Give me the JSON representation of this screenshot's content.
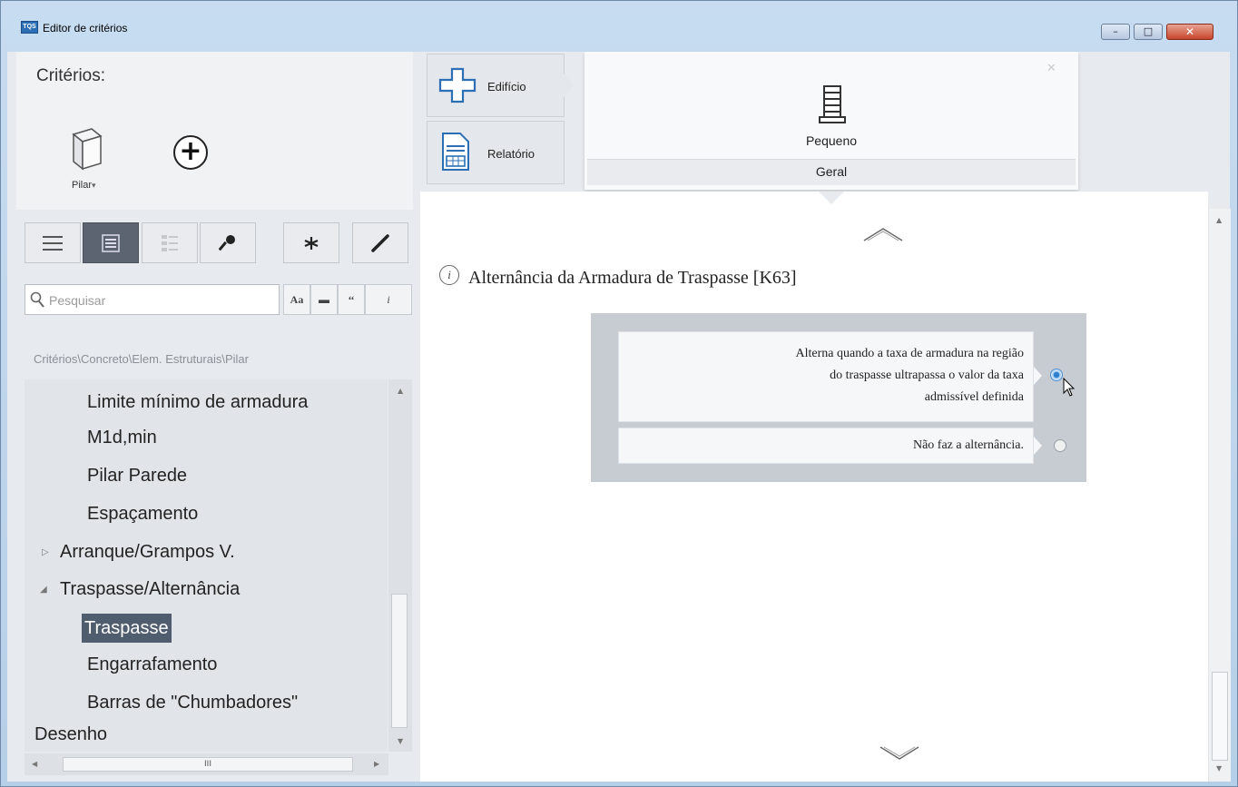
{
  "window": {
    "title": "Editor de critérios",
    "app_icon_text": "TQS",
    "controls": {
      "minimize": "–",
      "maximize": "□",
      "close": "✕"
    }
  },
  "left": {
    "criteria_title": "Critérios:",
    "element_selector": {
      "label": "Pilar",
      "dropdown_glyph": "▾",
      "icon": "cube-icon"
    },
    "add_button_glyph": "+",
    "toolbar": [
      {
        "name": "list-view-button",
        "icon": "list-icon",
        "active": false
      },
      {
        "name": "detail-list-view-button",
        "icon": "detail-list-icon",
        "active": true
      },
      {
        "name": "tree-view-button",
        "icon": "tree-list-icon",
        "active": false
      },
      {
        "name": "key-button",
        "icon": "key-icon",
        "active": false
      },
      {
        "name": "asterisk-button",
        "icon": "asterisk-icon",
        "active": false
      },
      {
        "name": "edit-button",
        "icon": "pencil-icon",
        "active": false
      }
    ],
    "search": {
      "placeholder": "Pesquisar",
      "value": "",
      "match_case_label": "Aa",
      "whole_word_label": "▬",
      "quote_label": "‘‘",
      "info_label": "i"
    },
    "breadcrumb": "Critérios\\Concreto\\Elem. Estruturais\\Pilar",
    "tree": [
      {
        "label": "Limite mínimo de armadura",
        "level": 2,
        "selected": false
      },
      {
        "label": "M1d,min",
        "level": 2,
        "selected": false
      },
      {
        "label": "Pilar Parede",
        "level": 2,
        "selected": false
      },
      {
        "label": "Espaçamento",
        "level": 2,
        "selected": false
      },
      {
        "label": "Arranque/Grampos V.",
        "level": 1,
        "expander": "▷",
        "selected": false
      },
      {
        "label": "Traspasse/Alternância",
        "level": 1,
        "expander": "◢",
        "selected": false
      },
      {
        "label": "Traspasse",
        "level": 2,
        "selected": true
      },
      {
        "label": "Engarrafamento",
        "level": 2,
        "selected": false
      },
      {
        "label": "Barras de \"Chumbadores\"",
        "level": 2,
        "selected": false
      },
      {
        "label": "Desenho",
        "level": 0,
        "selected": false
      }
    ],
    "hscroll_grip": "III"
  },
  "right": {
    "tabs": [
      {
        "label": "Edifício",
        "icon": "building-cross-icon"
      },
      {
        "label": "Relatório",
        "icon": "report-icon"
      }
    ],
    "size_card": {
      "label": "Pequeno",
      "band": "Geral",
      "icon": "small-building-icon",
      "close_glyph": "✕"
    },
    "section": {
      "info_glyph": "i",
      "title": "Alternância da Armadura de Traspasse [K63]"
    },
    "options": [
      {
        "lines": [
          "Alterna quando a taxa de armadura na região",
          "do traspasse ultrapassa o valor da taxa",
          "admissível definida"
        ],
        "selected": true
      },
      {
        "lines": [
          "Não faz a alternância."
        ],
        "selected": false
      }
    ]
  }
}
